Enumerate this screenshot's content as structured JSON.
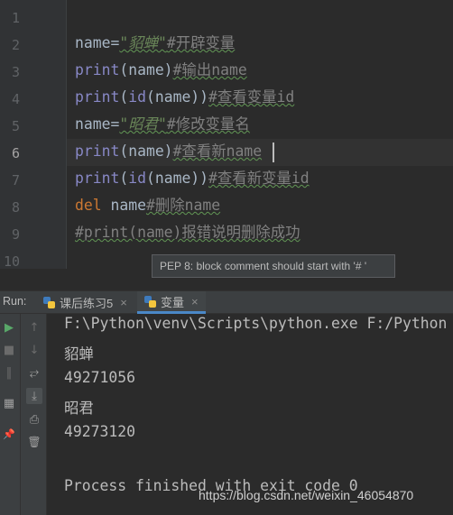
{
  "editor": {
    "line_numbers": [
      "1",
      "2",
      "3",
      "4",
      "5",
      "6",
      "7",
      "8",
      "9",
      "10"
    ],
    "active_line": "6",
    "lines": [
      {
        "parts": []
      },
      {
        "parts": [
          {
            "t": "name",
            "c": "id"
          },
          {
            "t": "=",
            "c": "op"
          },
          {
            "t": "\"貂蝉\"",
            "c": "str wavy"
          },
          {
            "t": "#开辟变量",
            "c": "cm wavy"
          }
        ]
      },
      {
        "parts": [
          {
            "t": "print",
            "c": "builtin"
          },
          {
            "t": "(name)",
            "c": "op"
          },
          {
            "t": "#输出name",
            "c": "cm wavy"
          }
        ]
      },
      {
        "parts": [
          {
            "t": "print",
            "c": "builtin"
          },
          {
            "t": "(",
            "c": "op"
          },
          {
            "t": "id",
            "c": "builtin"
          },
          {
            "t": "(name))",
            "c": "op"
          },
          {
            "t": "#查看变量id",
            "c": "cm wavy"
          }
        ]
      },
      {
        "parts": [
          {
            "t": "name",
            "c": "id"
          },
          {
            "t": "=",
            "c": "op"
          },
          {
            "t": "\"昭君\"",
            "c": "str wavy"
          },
          {
            "t": "#修改变量名",
            "c": "cm wavy"
          }
        ]
      },
      {
        "parts": [
          {
            "t": "print",
            "c": "builtin"
          },
          {
            "t": "(name)",
            "c": "op"
          },
          {
            "t": "#查看新name",
            "c": "cm wavy"
          }
        ]
      },
      {
        "parts": [
          {
            "t": "print",
            "c": "builtin"
          },
          {
            "t": "(",
            "c": "op"
          },
          {
            "t": "id",
            "c": "builtin"
          },
          {
            "t": "(name))",
            "c": "op"
          },
          {
            "t": "#查看新变量id",
            "c": "cm wavy"
          }
        ]
      },
      {
        "parts": [
          {
            "t": "del",
            "c": "kw"
          },
          {
            "t": " name",
            "c": "id"
          },
          {
            "t": "#删除name",
            "c": "cm wavy"
          }
        ]
      },
      {
        "parts": [
          {
            "t": "#print(name)报错说明删除成功",
            "c": "cm wavy"
          }
        ]
      },
      {
        "parts": []
      }
    ],
    "tooltip": "PEP 8: block comment should start with '# '"
  },
  "run_panel": {
    "label": "Run:",
    "tabs": [
      {
        "label": "课后练习5",
        "close": "×"
      },
      {
        "label": "变量",
        "close": "×"
      }
    ],
    "toolbar_icons": {
      "run": "▶",
      "up": "↑",
      "stop": "■",
      "down": "↓",
      "pause": "‖",
      "soft_wrap": "⥂",
      "layout": "▦",
      "scroll_end": "⤓",
      "pin": "📌",
      "print": "⎙",
      "delete": "🗑"
    },
    "console_lines": [
      "F:\\Python\\venv\\Scripts\\python.exe F:/Python",
      "貂蝉",
      "49271056",
      "昭君",
      "49273120",
      "",
      "Process finished with exit code 0"
    ]
  },
  "watermark": "https://blog.csdn.net/weixin_46054870",
  "colors": {
    "editor_bg": "#2b2b2b",
    "gutter_bg": "#313335",
    "panel_bg": "#3c3f41",
    "builtin": "#8888c6",
    "string": "#6a8759",
    "keyword": "#cc7832",
    "comment": "#808080",
    "run_green": "#59a869",
    "tab_underline": "#4a88c7"
  }
}
